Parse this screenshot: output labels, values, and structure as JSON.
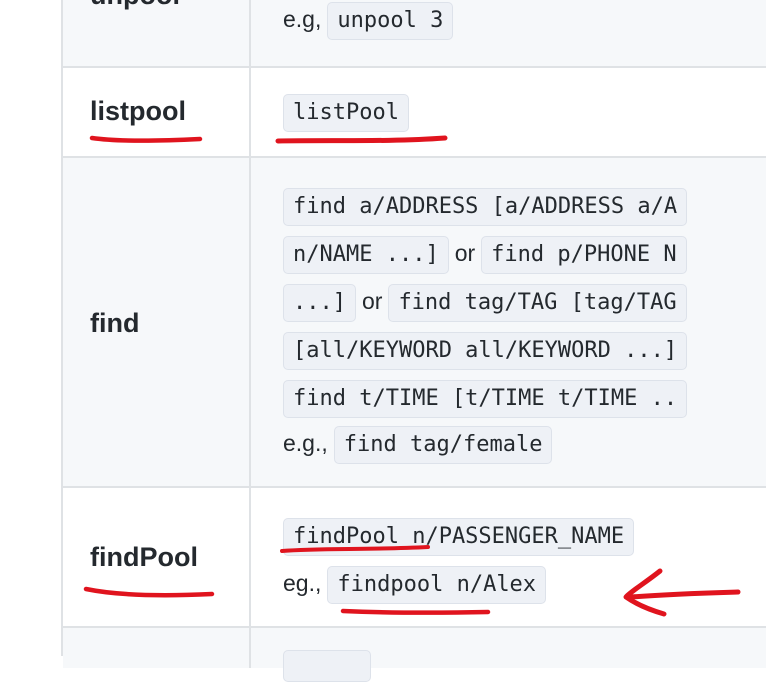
{
  "rows": [
    {
      "command": "unpool",
      "lines": [
        {
          "prefix": "e.g,",
          "code": "unpool 3"
        }
      ]
    },
    {
      "command": "listpool",
      "lines": [
        {
          "code": "listPool"
        }
      ]
    },
    {
      "command": "find",
      "lines": [
        {
          "code": "find a/ADDRESS [a/ADDRESS a/A"
        },
        {
          "code": "n/NAME ...]",
          "middle": "or",
          "code2": "find p/PHONE N"
        },
        {
          "code": "...]",
          "middle": "or",
          "code2": "find tag/TAG [tag/TAG"
        },
        {
          "code": "[all/KEYWORD all/KEYWORD ...]"
        },
        {
          "code": "find t/TIME [t/TIME t/TIME .."
        },
        {
          "prefix": "e.g.,",
          "code": "find tag/female"
        }
      ]
    },
    {
      "command": "findPool",
      "lines": [
        {
          "code": "findPool n/PASSENGER_NAME"
        },
        {
          "prefix": "eg.,",
          "code": "findpool n/Alex"
        }
      ]
    }
  ],
  "annotation_color": "#e0141e"
}
